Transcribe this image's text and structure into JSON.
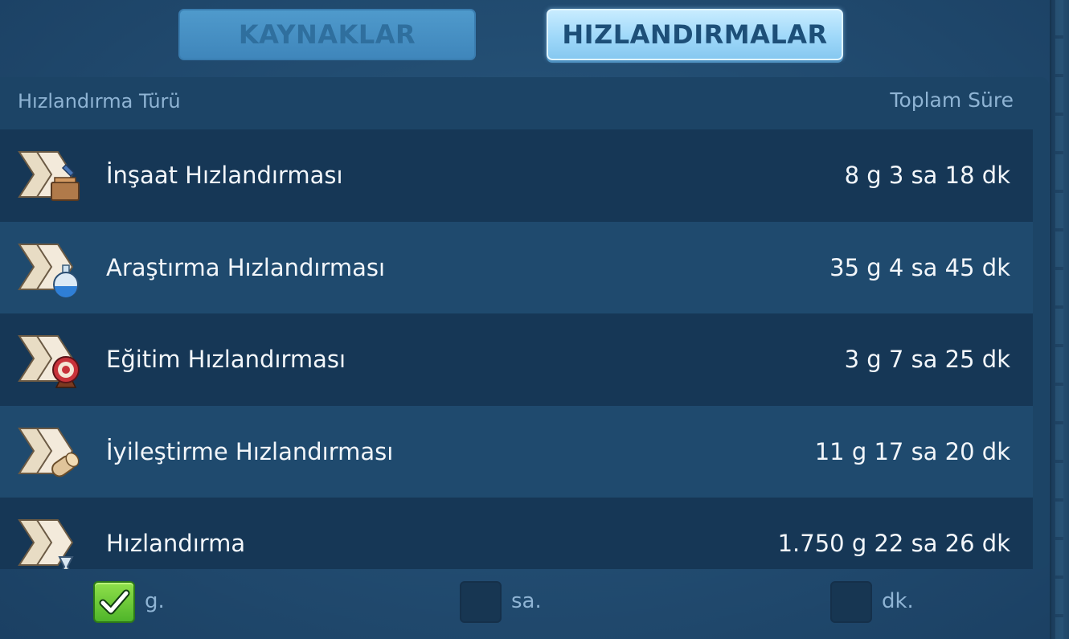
{
  "tabs": {
    "resources_label": "KAYNAKLAR",
    "speedups_label": "HIZLANDIRMALAR",
    "active": "speedups"
  },
  "table": {
    "header_type": "Hızlandırma Türü",
    "header_total": "Toplam Süre",
    "rows": [
      {
        "icon": "construction-speedup-icon",
        "label": "İnşaat Hızlandırması",
        "time": "8 g 3 sa 18 dk"
      },
      {
        "icon": "research-speedup-icon",
        "label": "Araştırma Hızlandırması",
        "time": "35 g 4 sa 45 dk"
      },
      {
        "icon": "training-speedup-icon",
        "label": "Eğitim Hızlandırması",
        "time": "3 g 7 sa 25 dk"
      },
      {
        "icon": "healing-speedup-icon",
        "label": "İyileştirme Hızlandırması",
        "time": "11 g 17 sa 20 dk"
      },
      {
        "icon": "universal-speedup-icon",
        "label": "Hızlandırma",
        "time": "1.750 g 22 sa 26 dk"
      }
    ]
  },
  "units": {
    "days": {
      "label": "g.",
      "checked": true
    },
    "hours": {
      "label": "sa.",
      "checked": false
    },
    "minutes": {
      "label": "dk.",
      "checked": false
    }
  },
  "colors": {
    "background": "#234e73",
    "row_dark": "#163756",
    "row_light": "#1f4a6e",
    "active_tab": "#9fd8f9",
    "checkbox_checked": "#4fb52a"
  }
}
